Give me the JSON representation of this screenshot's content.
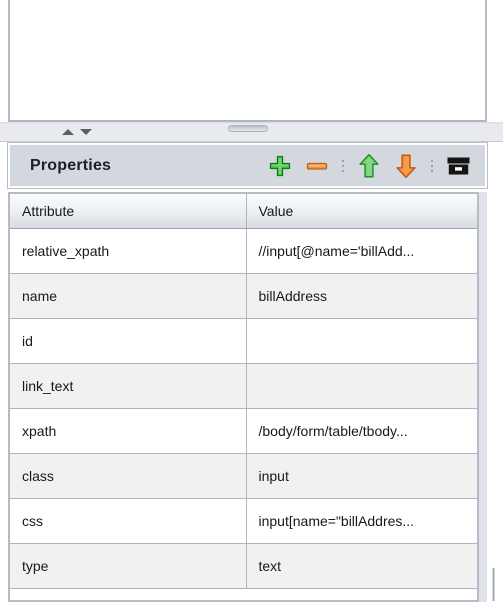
{
  "top_panel": {
    "content": ""
  },
  "splitter": {
    "collapse_up_icon": "triangle-up-icon",
    "collapse_down_icon": "triangle-down-icon",
    "drag_handle_icon": "drag-handle-icon"
  },
  "properties_panel": {
    "title": "Properties",
    "toolbar": [
      {
        "name": "add-button",
        "icon": "plus-icon",
        "color": "#3fbf3f"
      },
      {
        "name": "remove-button",
        "icon": "minus-icon",
        "color": "#f08a33"
      },
      {
        "name": "separator-1",
        "icon": "dotted-separator",
        "color": "#9aa0aa"
      },
      {
        "name": "move-up-button",
        "icon": "arrow-up-icon",
        "color": "#5cc45c"
      },
      {
        "name": "move-down-button",
        "icon": "arrow-down-icon",
        "color": "#f07a1e"
      },
      {
        "name": "separator-2",
        "icon": "dotted-separator",
        "color": "#9aa0aa"
      },
      {
        "name": "archive-button",
        "icon": "archive-box-icon",
        "color": "#1a1a1a"
      }
    ]
  },
  "attributes_table": {
    "columns": [
      "Attribute",
      "Value"
    ],
    "rows": [
      {
        "attribute": "relative_xpath",
        "value": "//input[@name='billAdd..."
      },
      {
        "attribute": "name",
        "value": "billAddress"
      },
      {
        "attribute": "id",
        "value": ""
      },
      {
        "attribute": "link_text",
        "value": ""
      },
      {
        "attribute": "xpath",
        "value": "/body/form/table/tbody..."
      },
      {
        "attribute": "class",
        "value": "input"
      },
      {
        "attribute": "css",
        "value": "input[name=\"billAddres..."
      },
      {
        "attribute": "type",
        "value": "text"
      }
    ]
  },
  "colors": {
    "panel_background": "#d3d7de",
    "table_header": "#eceef1",
    "row_alt": "#f1f1f1",
    "border": "#b0b5bd",
    "add_green": "#3fbf3f",
    "remove_orange": "#f08a33"
  }
}
